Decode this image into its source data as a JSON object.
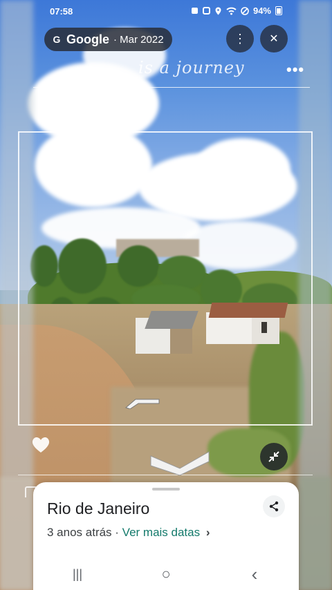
{
  "status_bar": {
    "time": "07:58",
    "battery": "94%",
    "icons": [
      "notification-icon",
      "notification-icon",
      "location-icon",
      "wifi-icon",
      "dnd-icon",
      "battery-icon"
    ]
  },
  "viewer": {
    "provider_glyph": "G",
    "provider": "Google",
    "date": "· Mar 2022",
    "overlay_text": "is a journey",
    "menu_glyph": "⋮",
    "close_glyph": "✕"
  },
  "place_card": {
    "title": "Rio de Janeiro",
    "ago": "3 anos atrás",
    "separator": " · ",
    "more_dates": "Ver mais datas",
    "chevron": "›"
  },
  "nav_bar": {
    "recents": "|||",
    "home": "○",
    "back": "‹"
  },
  "colors": {
    "link": "#137a6b",
    "pill_bg": "#2d323c",
    "button_bg": "#283246"
  }
}
